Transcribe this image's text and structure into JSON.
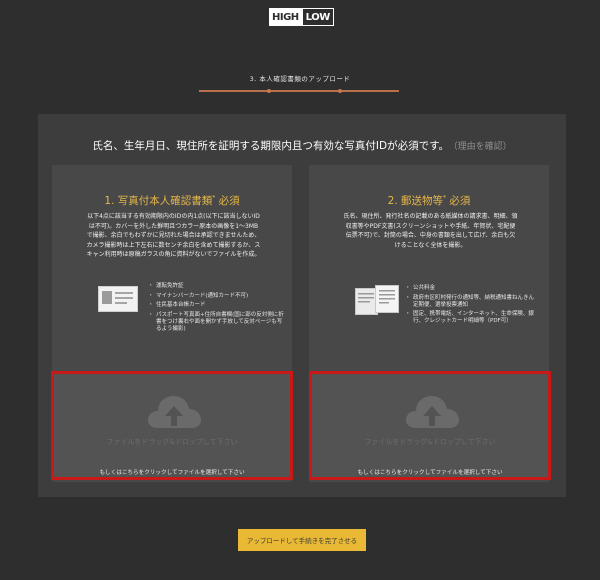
{
  "logo": {
    "high": "HIGH",
    "low": "LOW"
  },
  "step": {
    "label": "3. 本人確認書類のアップロード"
  },
  "intro": {
    "text": "氏名、生年月日、現住所を証明する期限内且つ有効な写真付IDが必須です。",
    "reason_link": "（理由を確認）"
  },
  "cards": [
    {
      "title": "1. 写真付本人確認書類",
      "title_mark": "*",
      "title_suffix": " 必須",
      "description": "以下4点に該当する有効期限内のIDの内1点(以下に該当しないIDは不可)。カバーを外した鮮明且つカラー原本の画像を1〜3MBで撮影、余白でもわずかに見切れた場合は承認できませんため、カメラ撮影時は上下左右に数センチ余白を含めて撮影するか、スキャン利用時は原稿ガラスの角に資料がないでファイルを作成。",
      "items": [
        "運転免許証",
        "マイナンバーカード(通知カード不可)",
        "住民基本台帳カード",
        "パスポート写真面+住所自書欄(国に部の反対側に折書をつけ裏右や面を開かず手放して反対ページも写るよう撮影)"
      ]
    },
    {
      "title": "2. 郵送物等",
      "title_mark": "*",
      "title_suffix": " 必須",
      "description": "氏名、現住所、発行社名の記載のある紙媒体の請求書、明細、領収書等やPDF文書(スクリーンショットや手紙、年賀状、宅配便伝票不可)で、封筒の場合、中身の書類を出して広げ、余白も欠けることなく全体を撮影。",
      "items": [
        "公共料金",
        "政府市区町村発行の通知等、納税通知書ねんきん定期便、選挙投票通知",
        "固定、携帯電話、インターネット、生命保険、銀行、クレジットカード明細等（PDF可）"
      ]
    }
  ],
  "dropzone": {
    "main": "ファイルをドラッグ&ドロップして下さい",
    "sub": "もしくはこちらをクリックしてファイルを選択して下さい"
  },
  "submit": {
    "label": "アップロードして手続きを完了させる"
  },
  "colors": {
    "background": "#2e2e2e",
    "panel": "#3d3d3d",
    "card": "#484848",
    "accent": "#e7b74a",
    "highlight_border": "#c81818",
    "button": "#e9b935",
    "progress": "#c77a4c"
  },
  "icons": [
    "upload-cloud-icon",
    "id-card-icon",
    "documents-icon"
  ]
}
